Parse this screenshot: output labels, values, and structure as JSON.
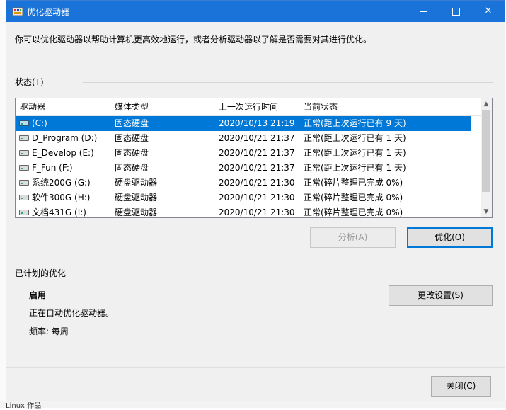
{
  "window": {
    "title": "优化驱动器"
  },
  "description": "你可以优化驱动器以帮助计算机更高效地运行，或者分析驱动器以了解是否需要对其进行优化。",
  "status_section": {
    "label": "状态(T)"
  },
  "table": {
    "columns": [
      "驱动器",
      "媒体类型",
      "上一次运行时间",
      "当前状态"
    ],
    "rows": [
      {
        "drive": "(C:)",
        "media": "固态硬盘",
        "last_run": "2020/10/13 21:19",
        "status": "正常(距上次运行已有 9 天)",
        "icon": "system-drive-icon",
        "selected": true
      },
      {
        "drive": "D_Program (D:)",
        "media": "固态硬盘",
        "last_run": "2020/10/21 21:37",
        "status": "正常(距上次运行已有 1 天)",
        "icon": "drive-icon",
        "selected": false
      },
      {
        "drive": "E_Develop (E:)",
        "media": "固态硬盘",
        "last_run": "2020/10/21 21:37",
        "status": "正常(距上次运行已有 1 天)",
        "icon": "drive-icon",
        "selected": false
      },
      {
        "drive": "F_Fun (F:)",
        "media": "固态硬盘",
        "last_run": "2020/10/21 21:37",
        "status": "正常(距上次运行已有 1 天)",
        "icon": "drive-icon",
        "selected": false
      },
      {
        "drive": "系统200G (G:)",
        "media": "硬盘驱动器",
        "last_run": "2020/10/21 21:30",
        "status": "正常(碎片整理已完成 0%)",
        "icon": "drive-icon",
        "selected": false
      },
      {
        "drive": "软件300G (H:)",
        "media": "硬盘驱动器",
        "last_run": "2020/10/21 21:30",
        "status": "正常(碎片整理已完成 0%)",
        "icon": "drive-icon",
        "selected": false
      },
      {
        "drive": "文档431G (I:)",
        "media": "硬盘驱动器",
        "last_run": "2020/10/21 21:30",
        "status": "正常(碎片整理已完成 0%)",
        "icon": "drive-icon",
        "selected": false
      }
    ]
  },
  "buttons": {
    "analyze": "分析(A)",
    "optimize": "优化(O)",
    "change_settings": "更改设置(S)",
    "close": "关闭(C)"
  },
  "schedule": {
    "label": "已计划的优化",
    "status": "启用",
    "auto_text": "正在自动优化驱动器。",
    "frequency": "频率: 每周"
  },
  "background": {
    "bottom_text": "Linux 作品"
  },
  "colors": {
    "titlebar": "#1a73d9",
    "selection": "#0078d7",
    "dialog_bg": "#f0f0f0"
  }
}
